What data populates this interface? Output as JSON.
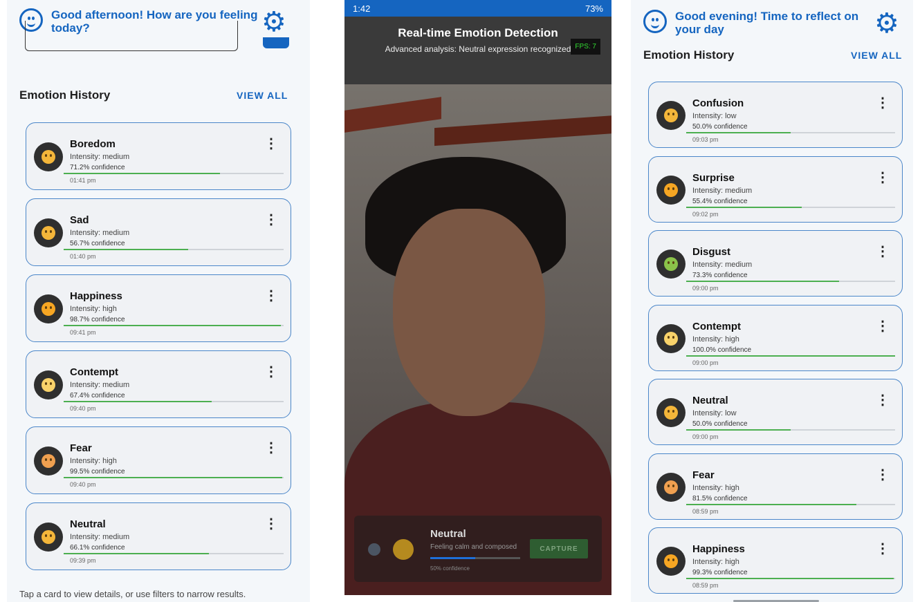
{
  "left": {
    "greeting": "Good afternoon! How are you feeling today?",
    "section_title": "Emotion History",
    "view_all": "VIEW ALL",
    "hint": "Tap a card to view details, or use filters to narrow results.",
    "cards": [
      {
        "name": "Boredom",
        "intensity": "Intensity: medium",
        "confidence": "71.2% confidence",
        "progress": 0.712,
        "time": "01:41 pm",
        "emoji_color": "#f4b63a"
      },
      {
        "name": "Sad",
        "intensity": "Intensity: medium",
        "confidence": "56.7% confidence",
        "progress": 0.567,
        "time": "01:40 pm",
        "emoji_color": "#f4b63a"
      },
      {
        "name": "Happiness",
        "intensity": "Intensity: high",
        "confidence": "98.7% confidence",
        "progress": 0.987,
        "time": "09:41 pm",
        "emoji_color": "#f6a623"
      },
      {
        "name": "Contempt",
        "intensity": "Intensity: medium",
        "confidence": "67.4% confidence",
        "progress": 0.674,
        "time": "09:40 pm",
        "emoji_color": "#f8d26a"
      },
      {
        "name": "Fear",
        "intensity": "Intensity: high",
        "confidence": "99.5% confidence",
        "progress": 0.995,
        "time": "09:40 pm",
        "emoji_color": "#f0a050"
      },
      {
        "name": "Neutral",
        "intensity": "Intensity: medium",
        "confidence": "66.1% confidence",
        "progress": 0.661,
        "time": "09:39 pm",
        "emoji_color": "#f4b63a"
      }
    ]
  },
  "camera": {
    "status_time": "1:42",
    "status_right": "73%",
    "title": "Real-time Emotion Detection",
    "subtitle": "Advanced analysis: Neutral expression recognized",
    "fps": "FPS: 7",
    "emotion_label": "Neutral",
    "emotion_desc": "Feeling calm and composed",
    "confidence": "50% confidence",
    "confidence_progress": 0.5,
    "capture": "CAPTURE"
  },
  "right": {
    "greeting": "Good evening! Time to reflect on your day",
    "section_title": "Emotion History",
    "view_all": "VIEW ALL",
    "cards": [
      {
        "name": "Confusion",
        "intensity": "Intensity: low",
        "confidence": "50.0% confidence",
        "progress": 0.5,
        "time": "09:03 pm",
        "emoji_color": "#f4b63a"
      },
      {
        "name": "Surprise",
        "intensity": "Intensity: medium",
        "confidence": "55.4% confidence",
        "progress": 0.554,
        "time": "09:02 pm",
        "emoji_color": "#f6a623"
      },
      {
        "name": "Disgust",
        "intensity": "Intensity: medium",
        "confidence": "73.3% confidence",
        "progress": 0.733,
        "time": "09:00 pm",
        "emoji_color": "#8bc34a"
      },
      {
        "name": "Contempt",
        "intensity": "Intensity: high",
        "confidence": "100.0% confidence",
        "progress": 1.0,
        "time": "09:00 pm",
        "emoji_color": "#f8d26a"
      },
      {
        "name": "Neutral",
        "intensity": "Intensity: low",
        "confidence": "50.0% confidence",
        "progress": 0.5,
        "time": "09:00 pm",
        "emoji_color": "#f4b63a"
      },
      {
        "name": "Fear",
        "intensity": "Intensity: high",
        "confidence": "81.5% confidence",
        "progress": 0.815,
        "time": "08:59 pm",
        "emoji_color": "#f0a050"
      },
      {
        "name": "Happiness",
        "intensity": "Intensity: high",
        "confidence": "99.3% confidence",
        "progress": 0.993,
        "time": "08:59 pm",
        "emoji_color": "#f6a623"
      }
    ]
  }
}
